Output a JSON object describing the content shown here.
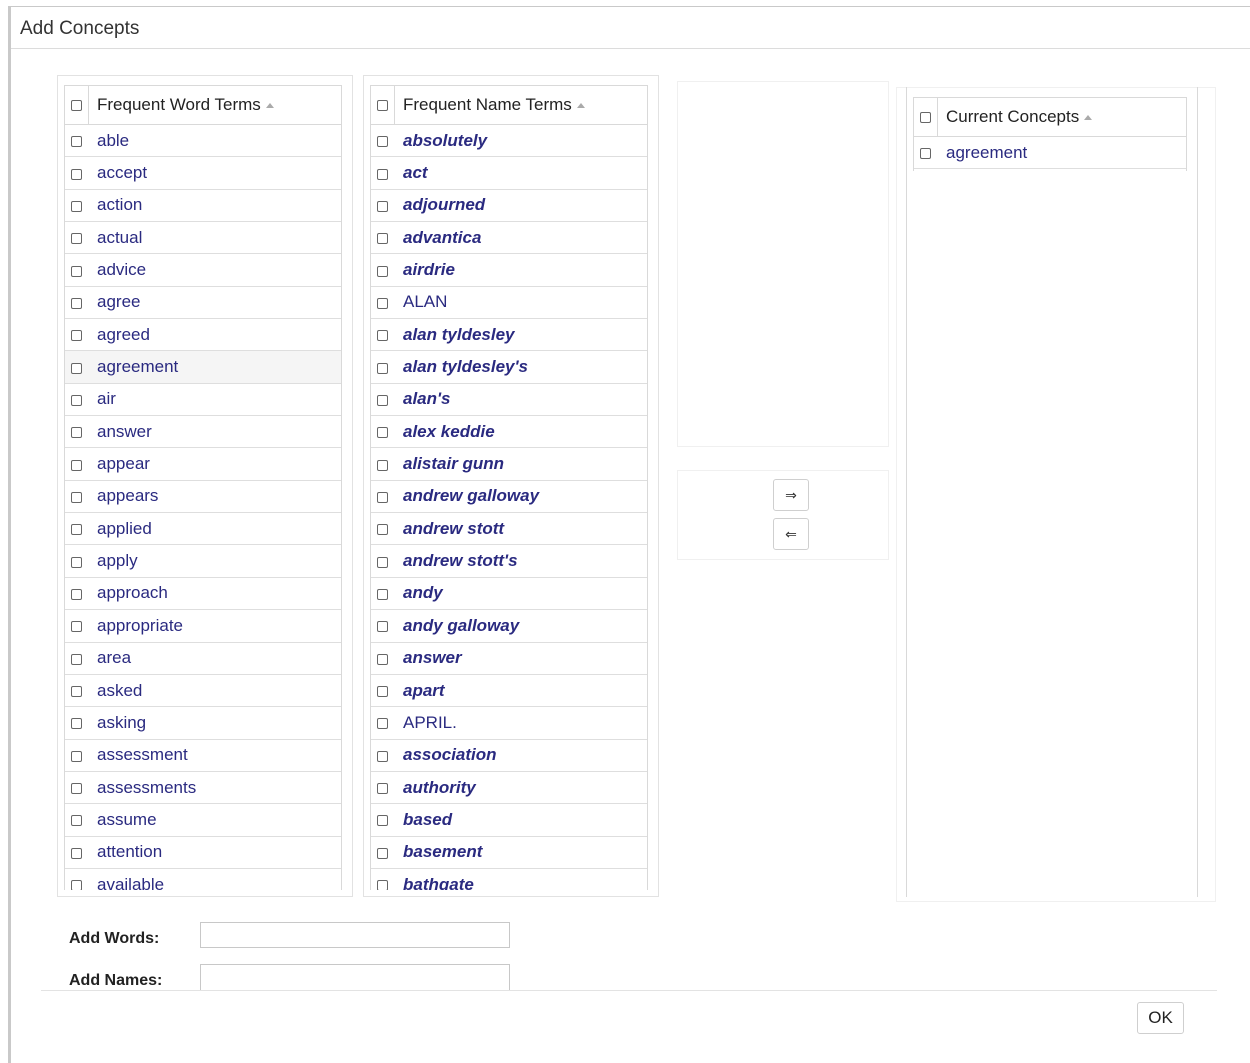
{
  "dialog": {
    "title": "Add Concepts"
  },
  "word_terms": {
    "header": "Frequent Word Terms",
    "items": [
      "able",
      "accept",
      "action",
      "actual",
      "advice",
      "agree",
      "agreed",
      "agreement",
      "air",
      "answer",
      "appear",
      "appears",
      "applied",
      "apply",
      "approach",
      "appropriate",
      "area",
      "asked",
      "asking",
      "assessment",
      "assessments",
      "assume",
      "attention",
      "available"
    ]
  },
  "name_terms": {
    "header": "Frequent Name Terms",
    "items": [
      "absolutely",
      "act",
      "adjourned",
      "advantica",
      "airdrie",
      "ALAN",
      "alan tyldesley",
      "alan tyldesley's",
      "alan's",
      "alex keddie",
      "alistair gunn",
      "andrew galloway",
      "andrew stott",
      "andrew stott's",
      "andy",
      "andy galloway",
      "answer",
      "apart",
      "APRIL.",
      "association",
      "authority",
      "based",
      "basement",
      "bathgate"
    ]
  },
  "current_concepts": {
    "header": "Current Concepts",
    "items": [
      "agreement"
    ]
  },
  "transfer": {
    "add_label": "⇒",
    "remove_label": "⇐"
  },
  "form": {
    "add_words_label": "Add Words:",
    "add_words_value": "",
    "add_names_label": "Add Names:",
    "add_names_value": ""
  },
  "footer": {
    "ok_label": "OK"
  }
}
